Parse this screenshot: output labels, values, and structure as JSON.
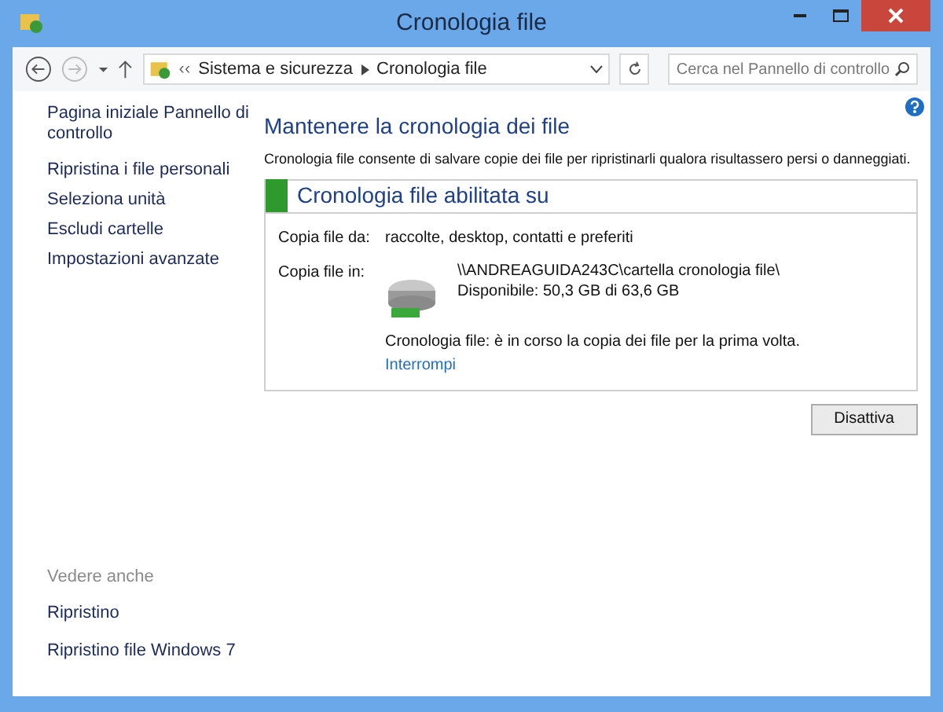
{
  "window": {
    "title": "Cronologia file"
  },
  "address_bar": {
    "prefix": "‹‹",
    "crumbs": [
      "Sistema e sicurezza",
      "Cronologia file"
    ]
  },
  "search": {
    "placeholder": "Cerca nel Pannello di controllo"
  },
  "sidebar": {
    "items": [
      "Pagina iniziale Pannello di controllo",
      "Ripristina i file personali",
      "Seleziona unità",
      "Escludi cartelle",
      "Impostazioni avanzate"
    ],
    "see_also": {
      "heading": "Vedere anche",
      "items": [
        "Ripristino",
        "Ripristino file Windows 7"
      ]
    }
  },
  "main": {
    "title": "Mantenere la cronologia dei file",
    "description": "Cronologia file consente di salvare copie dei file per ripristinarli qualora risultassero persi o danneggiati.",
    "status_panel": {
      "heading": "Cronologia file abilitata su",
      "copy_from_label": "Copia file da:",
      "copy_from_value": "raccolte, desktop, contatti e preferiti",
      "copy_to_label": "Copia file in:",
      "drive_path": "\\\\ANDREAGUIDA243C\\cartella cronologia file\\",
      "drive_space": "Disponibile: 50,3 GB di 63,6 GB",
      "progress_text": "Cronologia file: è in corso la copia dei file per la prima volta.",
      "stop_link": "Interrompi"
    },
    "buttons": [
      "Disattiva"
    ]
  }
}
